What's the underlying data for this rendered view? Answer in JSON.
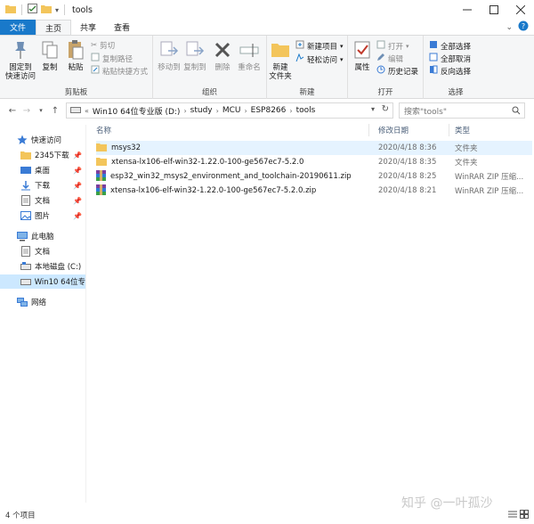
{
  "window": {
    "title": "tools"
  },
  "tabs": [
    "文件",
    "主页",
    "共享",
    "查看"
  ],
  "ribbon": {
    "clipboard": {
      "label": "剪贴板",
      "pin": "固定到\n快速访问",
      "copy": "复制",
      "paste": "粘贴",
      "cut": "剪切",
      "copy_path": "复制路径",
      "paste_shortcut": "粘贴快捷方式"
    },
    "organize": {
      "label": "组织",
      "move_to": "移动到",
      "copy_to": "复制到",
      "delete": "删除",
      "rename": "重命名"
    },
    "new": {
      "label": "新建",
      "new_folder": "新建\n文件夹",
      "new_item": "新建项目",
      "easy_access": "轻松访问"
    },
    "open": {
      "label": "打开",
      "properties": "属性",
      "open": "打开",
      "edit": "编辑",
      "history": "历史记录"
    },
    "select": {
      "label": "选择",
      "select_all": "全部选择",
      "select_none": "全部取消",
      "invert": "反向选择"
    }
  },
  "address": {
    "breadcrumbs": [
      "Win10 64位专业版 (D:)",
      "study",
      "MCU",
      "ESP8266",
      "tools"
    ],
    "search_placeholder": "搜索\"tools\""
  },
  "navpane": {
    "quick_access": "快速访问",
    "pinned": [
      "2345下载",
      "桌面",
      "下载",
      "文档",
      "图片"
    ],
    "this_pc": "此电脑",
    "pc_items": [
      "文档",
      "本地磁盘 (C:)",
      "Win10 64位专"
    ],
    "network": "网络"
  },
  "columns": {
    "name": "名称",
    "date": "修改日期",
    "type": "类型"
  },
  "files": [
    {
      "name": "msys32",
      "date": "2020/4/18 8:36",
      "type": "文件夹",
      "kind": "folder"
    },
    {
      "name": "xtensa-lx106-elf-win32-1.22.0-100-ge567ec7-5.2.0",
      "date": "2020/4/18 8:35",
      "type": "文件夹",
      "kind": "folder"
    },
    {
      "name": "esp32_win32_msys2_environment_and_toolchain-20190611.zip",
      "date": "2020/4/18 8:25",
      "type": "WinRAR ZIP 压缩...",
      "kind": "zip"
    },
    {
      "name": "xtensa-lx106-elf-win32-1.22.0-100-ge567ec7-5.2.0.zip",
      "date": "2020/4/18 8:21",
      "type": "WinRAR ZIP 压缩...",
      "kind": "zip"
    }
  ],
  "status": {
    "count": "4 个项目"
  },
  "watermark": "知乎 @一叶孤沙",
  "colors": {
    "accent": "#1979ca",
    "folder": "#f3c55b",
    "selection": "#cce8ff"
  }
}
